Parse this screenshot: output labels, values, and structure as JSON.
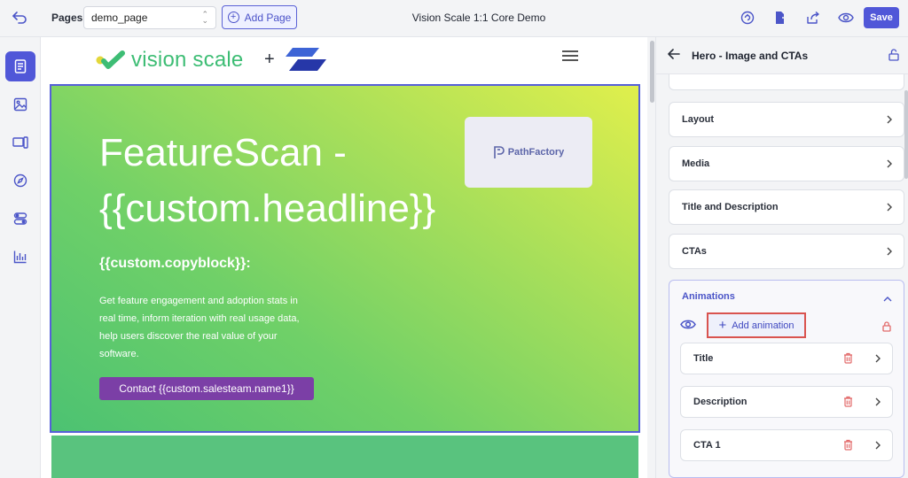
{
  "topbar": {
    "pages_label": "Pages:",
    "page_select_value": "demo_page",
    "add_page_label": "Add Page",
    "app_title": "Vision Scale 1:1 Core Demo",
    "save_label": "Save",
    "icons": [
      "undo-icon",
      "refresh-icon",
      "export-icon",
      "share-icon",
      "preview-eye-icon"
    ]
  },
  "leftrail": {
    "items": [
      "pages-icon",
      "image-icon",
      "device-icon",
      "compass-icon",
      "toggles-icon",
      "analytics-icon"
    ],
    "active": "pages-icon"
  },
  "canvas": {
    "logo_text": "vision scale",
    "plus": "+",
    "hero": {
      "title": "FeatureScan - {{custom.headline}}",
      "copyblock": "{{custom.copyblock}}:",
      "description": "Get feature engagement and adoption stats in real time, inform iteration with real usage data, help users discover the real value of your software.",
      "cta_label": "Contact {{custom.salesteam.name1}}",
      "partner_card_text": "PathFactory"
    },
    "colors": {
      "hero_start": "#e0ef4c",
      "hero_end": "#4cc272",
      "cta_bg": "#7b3fa6",
      "selection": "#5660d8"
    }
  },
  "panel": {
    "title": "Hero - Image and CTAs",
    "sections": [
      "Layout",
      "Media",
      "Title and Description",
      "CTAs"
    ],
    "animations": {
      "title": "Animations",
      "add_label": "Add animation",
      "items": [
        "Title",
        "Description",
        "CTA 1"
      ]
    }
  },
  "theme": {
    "accent": "#5057d8",
    "danger": "#e26a6a"
  }
}
